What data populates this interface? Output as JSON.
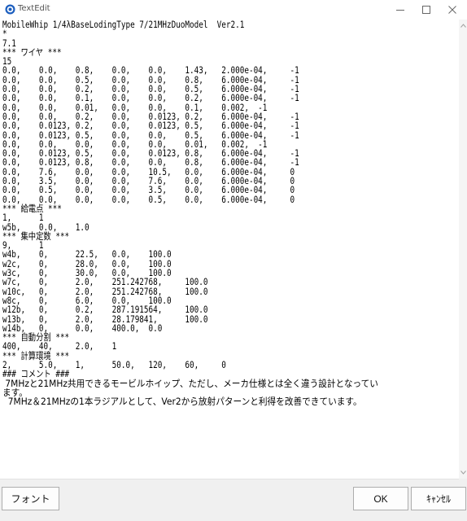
{
  "window": {
    "title": "TextEdit"
  },
  "editor": {
    "lines": [
      "MobileWhip 1/4λBaseLodingType 7/21MHzDuoModel  Ver2.1",
      "*",
      "7.1",
      "*** ワイヤ ***",
      "15",
      "0.0,    0.0,    0.8,    0.0,    0.0,    1.43,   2.000e-04,     -1",
      "0.0,    0.0,    0.5,    0.0,    0.0,    0.8,    6.000e-04,     -1",
      "0.0,    0.0,    0.2,    0.0,    0.0,    0.5,    6.000e-04,     -1",
      "0.0,    0.0,    0.1,    0.0,    0.0,    0.2,    6.000e-04,     -1",
      "0.0,    0.0,    0.01,   0.0,    0.0,    0.1,    0.002,  -1",
      "0.0,    0.0,    0.2,    0.0,    0.0123, 0.2,    6.000e-04,     -1",
      "0.0,    0.0123, 0.2,    0.0,    0.0123, 0.5,    6.000e-04,     -1",
      "0.0,    0.0123, 0.5,    0.0,    0.0,    0.5,    6.000e-04,     -1",
      "0.0,    0.0,    0.0,    0.0,    0.0,    0.01,   0.002,  -1",
      "0.0,    0.0123, 0.5,    0.0,    0.0123, 0.8,    6.000e-04,     -1",
      "0.0,    0.0123, 0.8,    0.0,    0.0,    0.8,    6.000e-04,     -1",
      "0.0,    7.6,    0.0,    0.0,    10.5,   0.0,    6.000e-04,     0",
      "0.0,    3.5,    0.0,    0.0,    7.6,    0.0,    6.000e-04,     0",
      "0.0,    0.5,    0.0,    0.0,    3.5,    0.0,    6.000e-04,     0",
      "0.0,    0.0,    0.0,    0.0,    0.5,    0.0,    6.000e-04,     0",
      "*** 給電点 ***",
      "1,      1",
      "w5b,    0.0,    1.0",
      "*** 集中定数 ***",
      "9,      1",
      "w4b,    0,      22.5,   0.0,    100.0",
      "w2c,    0,      28.0,   0.0,    100.0",
      "w3c,    0,      30.0,   0.0,    100.0",
      "w7c,    0,      2.0,    251.242768,     100.0",
      "w10c,   0,      2.0,    251.242768,     100.0",
      "w8c,    0,      6.0,    0.0,    100.0",
      "w12b,   0,      0.2,    287.191564,     100.0",
      "w13b,   0,      2.0,    28.179841,      100.0",
      "w14b,   0,      0.0,    400.0,  0.0",
      "*** 自動分割 ***",
      "400,    40,     2.0,    1",
      "*** 計算環境 ***",
      "2,      5.0,    1,      50.0,   120,    60,     0",
      "### コメント ###"
    ],
    "comment_lines": [
      " 7MHzと21MHz共用できるモービルホイップ、ただし、メーカ仕様とは全く違う設計となってい",
      "ます。",
      "  7MHz＆21MHzの1本ラジアルとして、Ver2から放射パターンと利得を改善できています。"
    ]
  },
  "buttons": {
    "font": "フォント",
    "ok": "OK",
    "cancel": "ｷｬﾝｾﾙ"
  },
  "icons": {
    "app": "texteditor-app-icon",
    "minimize": "minimize-icon",
    "maximize": "maximize-icon",
    "close": "close-icon",
    "scroll_up": "scroll-up-arrow-icon",
    "scroll_down": "scroll-down-arrow-icon"
  },
  "colors": {
    "app_icon": "#1d5fbf",
    "background": "#f0f0f0",
    "editor": "#ffffff"
  }
}
